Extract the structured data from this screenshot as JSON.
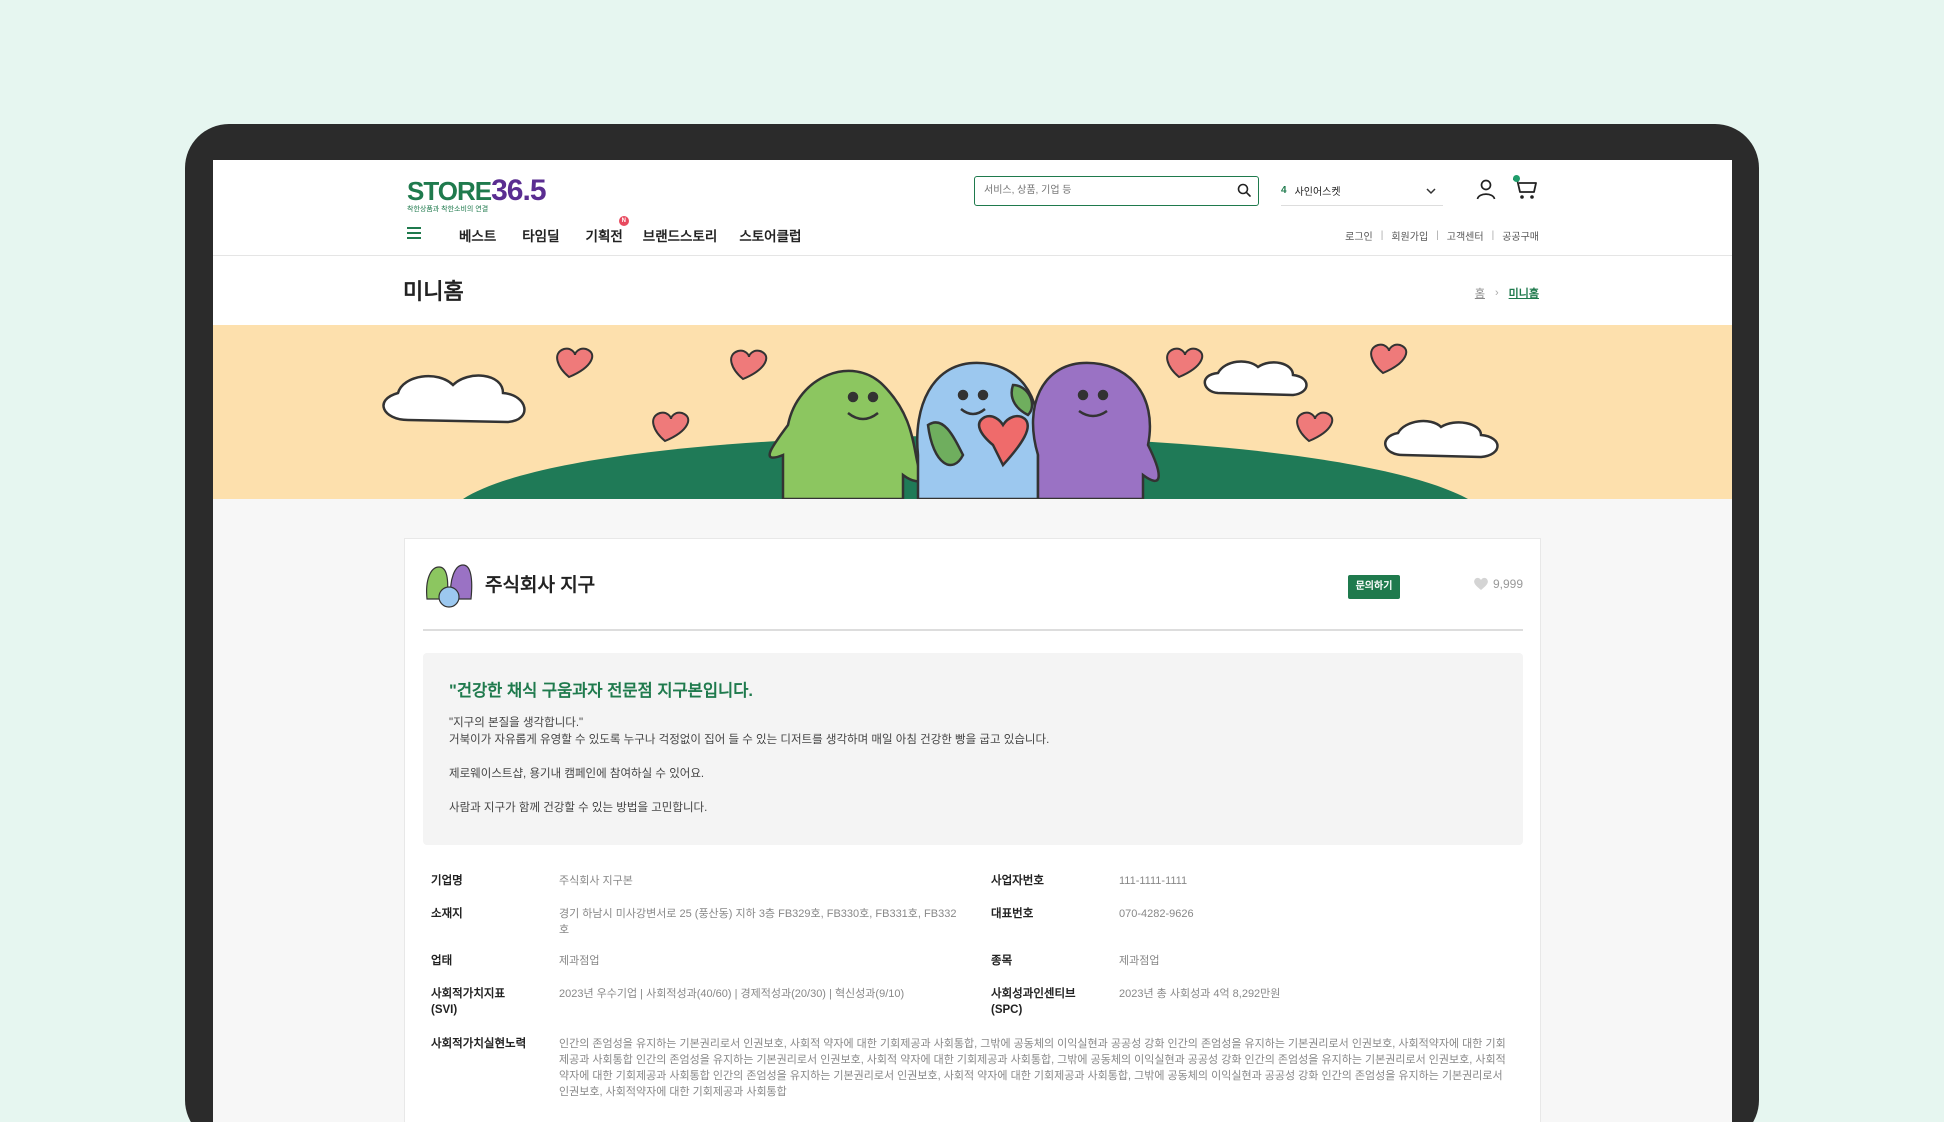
{
  "header": {
    "logo_store": "STORE",
    "logo_num": "36.5",
    "logo_tagline": "착한상품과 착한소비의 연결",
    "search_placeholder": "서비스, 상품, 기업 등",
    "company_num": "4",
    "company_name": "사인어스켓",
    "nav": [
      {
        "label": "베스트"
      },
      {
        "label": "타임딜"
      },
      {
        "label": "기획전",
        "badge": "N"
      },
      {
        "label": "브랜드스토리"
      },
      {
        "label": "스토어클럽"
      }
    ],
    "util": [
      "로그인",
      "회원가입",
      "고객센터",
      "공공구매"
    ]
  },
  "titlebar": {
    "title": "미니홈",
    "breadcrumb_home": "홈",
    "breadcrumb_current": "미니홈"
  },
  "company": {
    "name": "주식회사 지구",
    "inquiry_label": "문의하기",
    "likes": "9,999"
  },
  "intro": {
    "title": "\"건강한 채식 구움과자 전문점 지구본입니다.",
    "line1": "\"지구의 본질을 생각합니다.\"",
    "line2": "거북이가 자유롭게 유영할 수 있도록 누구나 걱정없이 집어 들 수 있는 디저트를 생각하며 매일 아침 건강한 빵을 굽고 있습니다.",
    "line3": "제로웨이스트샵, 용기내 캠페인에 참여하실 수 있어요.",
    "line4": "사람과 지구가 함께 건강할 수 있는 방법을 고민합니다."
  },
  "info": {
    "company_label": "기업명",
    "company_value": "주식회사 지구본",
    "bizno_label": "사업자번호",
    "bizno_value": "111-1111-1111",
    "address_label": "소재지",
    "address_value": "경기 하남시 미사강변서로 25 (풍산동) 지하 3층 FB329호, FB330호, FB331호, FB332호",
    "phone_label": "대표번호",
    "phone_value": "070-4282-9626",
    "biztype_label": "업태",
    "biztype_value": "제과점업",
    "item_label": "종목",
    "item_value": "제과점업",
    "svi_label": "사회적가치지표 (SVI)",
    "svi_value": "2023년 우수기업 | 사회적성과(40/60) | 경제적성과(20/30) | 혁신성과(9/10)",
    "spc_label": "사회성과인센티브 (SPC)",
    "spc_value": "2023년 총 사회성과 4억 8,292만원",
    "effort_label": "사회적가치실현노력",
    "effort_value": "인간의 존엄성을 유지하는 기본권리로서 인권보호, 사회적 약자에 대한 기회제공과 사회통합, 그밖에 공동체의 이익실현과 공공성 강화 인간의 존엄성을 유지하는 기본권리로서 인권보호, 사회적약자에 대한 기회제공과 사회통합 인간의 존엄성을 유지하는 기본권리로서 인권보호, 사회적 약자에 대한 기회제공과 사회통합, 그밖에 공동체의 이익실현과 공공성 강화 인간의 존엄성을 유지하는 기본권리로서 인권보호, 사회적약자에 대한 기회제공과 사회통합 인간의 존엄성을 유지하는 기본권리로서 인권보호, 사회적 약자에 대한 기회제공과 사회통합, 그밖에 공동체의 이익실현과 공공성 강화 인간의 존엄성을 유지하는 기본권리로서 인권보호, 사회적약자에 대한 기회제공과 사회통합"
  },
  "colors": {
    "brand_green": "#1f7a4d",
    "brand_purple": "#5a2d91",
    "banner_bg": "#fde0ad",
    "page_bg": "#e6f6f0"
  }
}
